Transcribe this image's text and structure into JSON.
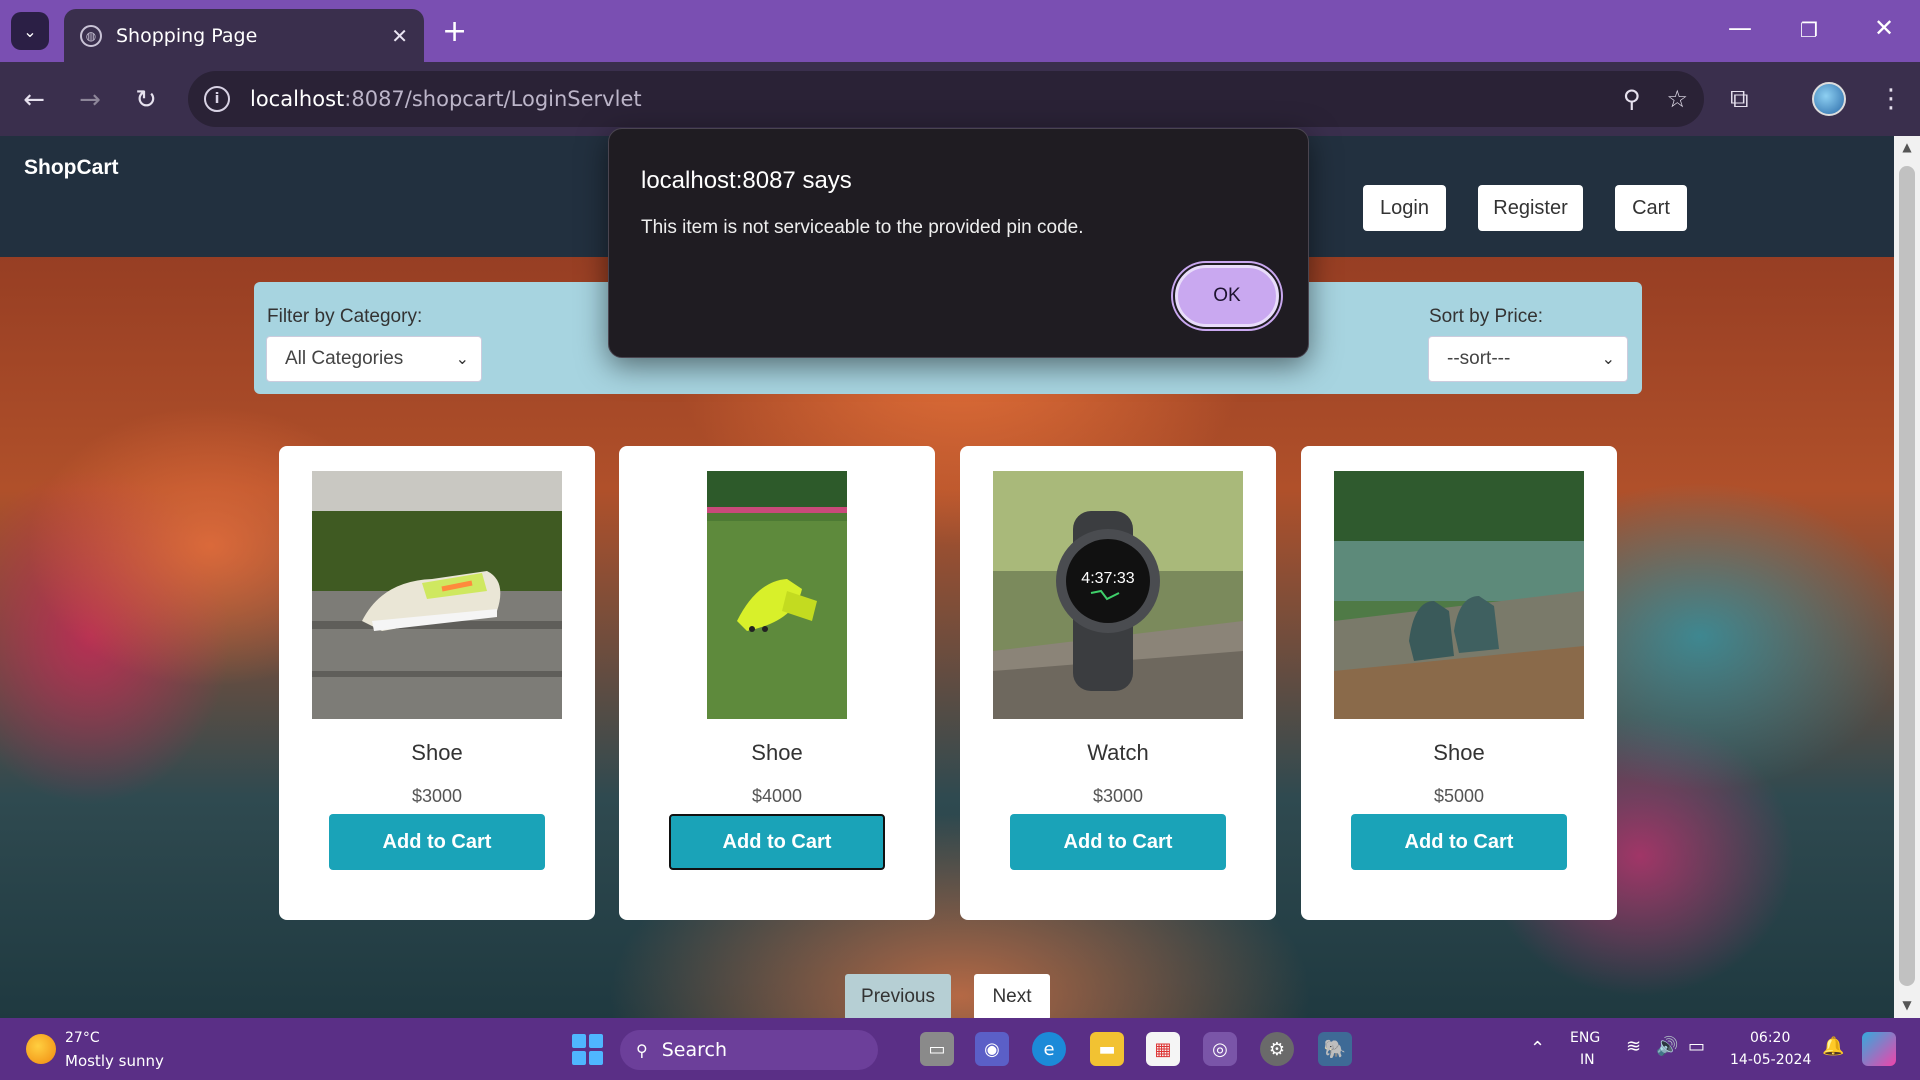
{
  "browser": {
    "tab_title": "Shopping Page",
    "url_host": "localhost",
    "url_rest": ":8087/shopcart/LoginServlet",
    "tab_close": "✕",
    "new_tab": "+"
  },
  "site": {
    "brand": "ShopCart",
    "nav": {
      "login": "Login",
      "register": "Register",
      "cart": "Cart"
    },
    "filter": {
      "category_label": "Filter by Category:",
      "category_value": "All Categories",
      "sort_label": "Sort by Price:",
      "sort_value": "--sort---"
    },
    "products": [
      {
        "name": "Shoe",
        "price": "$3000",
        "button": "Add to Cart"
      },
      {
        "name": "Shoe",
        "price": "$4000",
        "button": "Add to Cart"
      },
      {
        "name": "Watch",
        "price": "$3000",
        "button": "Add to Cart",
        "watch_time": "4:37:33"
      },
      {
        "name": "Shoe",
        "price": "$5000",
        "button": "Add to Cart"
      }
    ],
    "pager": {
      "previous": "Previous",
      "next": "Next"
    }
  },
  "dialog": {
    "title": "localhost:8087 says",
    "message": "This item is not serviceable to the provided pin code.",
    "ok": "OK"
  },
  "taskbar": {
    "weather_temp": "27°C",
    "weather_desc": "Mostly sunny",
    "search": "Search",
    "lang_top": "ENG",
    "lang_bottom": "IN",
    "time": "06:20",
    "date": "14-05-2024"
  },
  "colors": {
    "tab_strip": "#7a4fb2",
    "header": "#22303f",
    "filter_bar": "#a7d4e0",
    "add_button": "#1aa3b8",
    "dialog_ok": "#c9a8f0"
  }
}
